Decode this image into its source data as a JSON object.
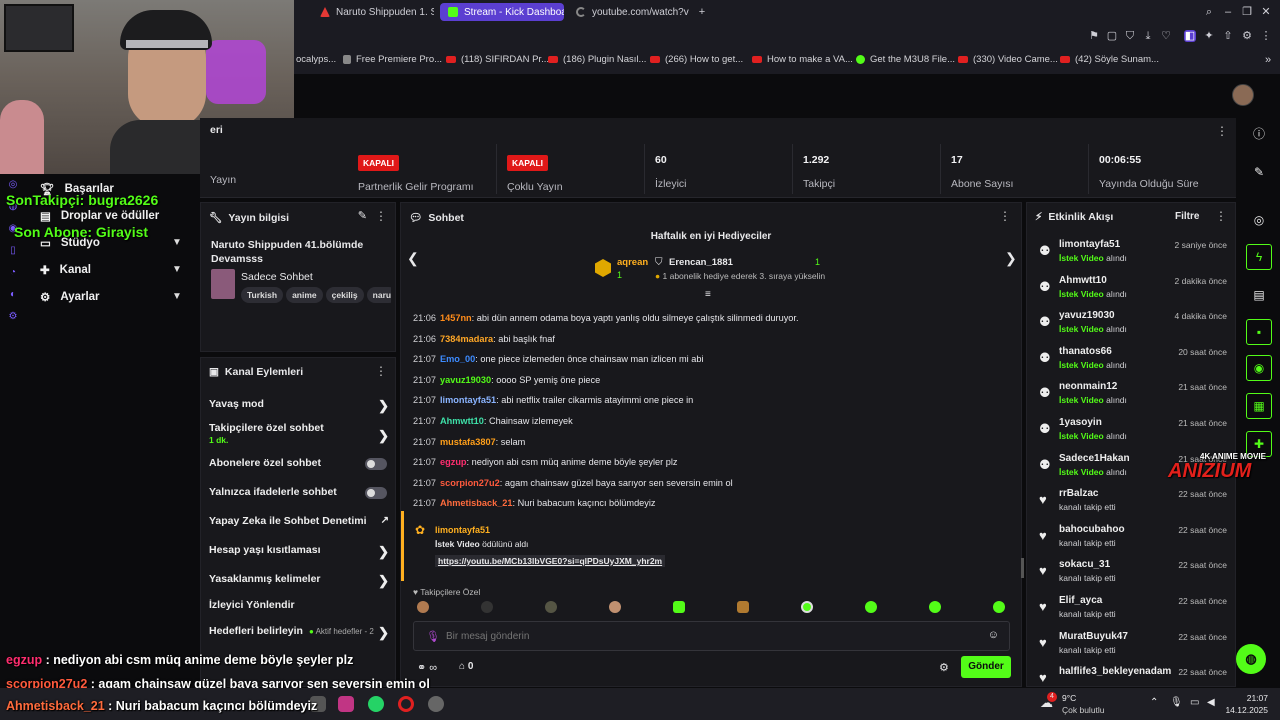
{
  "tabs": [
    {
      "label": "Naruto Shippuden 1. Sezo",
      "color": "#e53935"
    },
    {
      "label": "Stream - Kick Dashboard",
      "color": "#53fc18",
      "active": true
    },
    {
      "label": "youtube.com/watch?v",
      "color": "#888"
    }
  ],
  "bookmarks": [
    "ocalyps...",
    "Free Premiere Pro...",
    "(118) SIFIRDAN Pr...",
    "(186) Plugin Nasıl...",
    "(266) How to get...",
    "How to make a VA...",
    "Get the M3U8 File...",
    "(330) Video Came...",
    "(42) Söyle Sunam..."
  ],
  "header": {
    "title_fragment": "eri"
  },
  "stats": {
    "stream": {
      "label": "Yayın"
    },
    "partner": {
      "badge": "KAPALI",
      "label": "Partnerlik Gelir Programı"
    },
    "multi": {
      "badge": "KAPALI",
      "label": "Çoklu Yayın"
    },
    "viewers": {
      "value": "60",
      "label": "İzleyici"
    },
    "followers": {
      "value": "1.292",
      "label": "Takipçi"
    },
    "subs": {
      "value": "17",
      "label": "Abone Sayısı"
    },
    "uptime": {
      "value": "00:06:55",
      "label": "Yayında Olduğu Süre"
    }
  },
  "nav": {
    "basarilar": "Başarılar",
    "droplar": "Droplar ve ödüller",
    "studyo": "Stüdyo",
    "kanal": "Kanal",
    "ayarlar": "Ayarlar"
  },
  "stream_info": {
    "title": "Yayın bilgisi",
    "stream_title": "Naruto Shippuden 41.bölümde Devamsss",
    "category": "Sadece Sohbet",
    "tags": [
      "Turkish",
      "anime",
      "çekiliş",
      "naru"
    ]
  },
  "actions": {
    "title": "Kanal Eylemleri",
    "slow": "Yavaş mod",
    "followers_only": "Takipçilere özel sohbet",
    "followers_only_sub": "1 dk.",
    "subs_only": "Abonelere özel sohbet",
    "emotes_only": "Yalnızca ifadelerle sohbet",
    "ai_mod": "Yapay Zeka ile Sohbet Denetimi",
    "age": "Hesap yaşı kısıtlaması",
    "banned": "Yasaklanmış kelimeler",
    "guide": "İzleyici Yönlendir",
    "goals": "Hedefleri belirleyin",
    "goals_status": "Aktif hedefler - 2"
  },
  "chat": {
    "title": "Sohbet",
    "gifters_title": "Haftalık en iyi Hediyeciler",
    "gifter1": {
      "name": "aqrean",
      "count": "1"
    },
    "gifter2": {
      "name": "Erencan_1881",
      "count": "1"
    },
    "gift_note": "1 abonelik hediye ederek 3. sıraya yükselin",
    "messages": [
      {
        "time": "21:06",
        "user": "1457nn",
        "color": "#ff8c1a",
        "text": "abi dün annem odama boya yaptı yanlış oldu silmeye çalıştık silinmedi duruyor."
      },
      {
        "time": "21:06",
        "user": "7384madara",
        "color": "#ffa726",
        "text": "abi başlık fnaf"
      },
      {
        "time": "21:07",
        "user": "Emo_00",
        "color": "#3d8bff",
        "text": "one piece izlemeden önce chainsaw man izlicen mi abi"
      },
      {
        "time": "21:07",
        "user": "yavuz19030",
        "color": "#53fc18",
        "text": "oooo SP yemiş öne piece"
      },
      {
        "time": "21:07",
        "user": "limontayfa51",
        "color": "#8ab4ff",
        "text": "abi netflix trailer cikarmis atayimmi one piece in"
      },
      {
        "time": "21:07",
        "user": "Ahmwtt10",
        "color": "#3ee0a8",
        "text": "Chainsaw izlemeyek"
      },
      {
        "time": "21:07",
        "user": "mustafa3807",
        "color": "#ff9f1a",
        "text": "selam"
      },
      {
        "time": "21:07",
        "user": "egzup",
        "color": "#ff2d6f",
        "text": "nediyon abi csm müq anime deme böyle şeyler plz"
      },
      {
        "time": "21:07",
        "user": "scorpion27u2",
        "color": "#ff5a3d",
        "text": "agam chainsaw güzel baya sarıyor sen seversin emin ol"
      },
      {
        "time": "21:07",
        "user": "Ahmetisback_21",
        "color": "#ff6b3d",
        "text": "Nuri babacum kaçıncı bölümdeyiz"
      }
    ],
    "reward_user": "limontayfa51",
    "reward_name": "İstek Video",
    "reward_suffix": " ödülünü aldı",
    "reward_link": "https://youtu.be/MCb13lbVGE0?si=qlPDsUyJXM_yhr2m",
    "followers_only_label": "Takipçilere Özel",
    "input_placeholder": "Bir mesaj gönderin",
    "points": "0",
    "send": "Gönder"
  },
  "activity": {
    "title": "Etkinlik Akışı",
    "filter": "Filtre",
    "items": [
      {
        "user": "limontayfa51",
        "pre": "",
        "bold": "İstek Video",
        "post": " alındı",
        "time": "2 saniye önce",
        "icon": "reward"
      },
      {
        "user": "Ahmwtt10",
        "pre": "",
        "bold": "İstek Video",
        "post": " alındı",
        "time": "2 dakika önce",
        "icon": "reward"
      },
      {
        "user": "yavuz19030",
        "pre": "",
        "bold": "İstek Video",
        "post": " alındı",
        "time": "4 dakika önce",
        "icon": "reward"
      },
      {
        "user": "thanatos66",
        "pre": "",
        "bold": "İstek Video",
        "post": " alındı",
        "time": "20 saat önce",
        "icon": "reward"
      },
      {
        "user": "neonmain12",
        "pre": "",
        "bold": "İstek Video",
        "post": " alındı",
        "time": "21 saat önce",
        "icon": "reward"
      },
      {
        "user": "1yasoyin",
        "pre": "",
        "bold": "İstek Video",
        "post": " alındı",
        "time": "21 saat önce",
        "icon": "reward"
      },
      {
        "user": "Sadece1Hakan",
        "pre": "",
        "bold": "İstek Video",
        "post": " alındı",
        "time": "21 saat önce",
        "icon": "reward"
      },
      {
        "user": "rrBalzac",
        "pre": "kanalı takip etti",
        "bold": "",
        "post": "",
        "time": "22 saat önce",
        "icon": "heart"
      },
      {
        "user": "bahocubahoo",
        "pre": "kanalı takip etti",
        "bold": "",
        "post": "",
        "time": "22 saat önce",
        "icon": "heart"
      },
      {
        "user": "sokacu_31",
        "pre": "kanalı takip etti",
        "bold": "",
        "post": "",
        "time": "22 saat önce",
        "icon": "heart"
      },
      {
        "user": "Elif_ayca",
        "pre": "kanalı takip etti",
        "bold": "",
        "post": "",
        "time": "22 saat önce",
        "icon": "heart"
      },
      {
        "user": "MuratBuyuk47",
        "pre": "kanalı takip etti",
        "bold": "",
        "post": "",
        "time": "22 saat önce",
        "icon": "heart"
      },
      {
        "user": "halflife3_bekleyenadam",
        "pre": "",
        "bold": "",
        "post": "",
        "time": "22 saat önce",
        "icon": "heart"
      }
    ]
  },
  "overlay": {
    "last_follower": "SonTakipçi: bugra2626",
    "last_sub": "Son Abone: Girayist",
    "chat1_user": "egzup",
    "chat1_text": " : nediyon abi csm müq anime deme böyle şeyler plz",
    "chat2_user": "scorpion27u2",
    "chat2_text": " : agam chainsaw güzel baya sarıyor sen seversin emin ol",
    "chat3_user": "Ahmetisback_21",
    "chat3_text": " : Nuri babacum kaçıncı bölümdeyiz",
    "watermark_line1": "4K ANIME MOVIE",
    "watermark_line2": "ANIZIUM"
  },
  "taskbar": {
    "weather_temp": "9°C",
    "weather_desc": "Çok bulutlu",
    "time": "21:07",
    "date": "14.12.2025",
    "notif_count": "4"
  }
}
